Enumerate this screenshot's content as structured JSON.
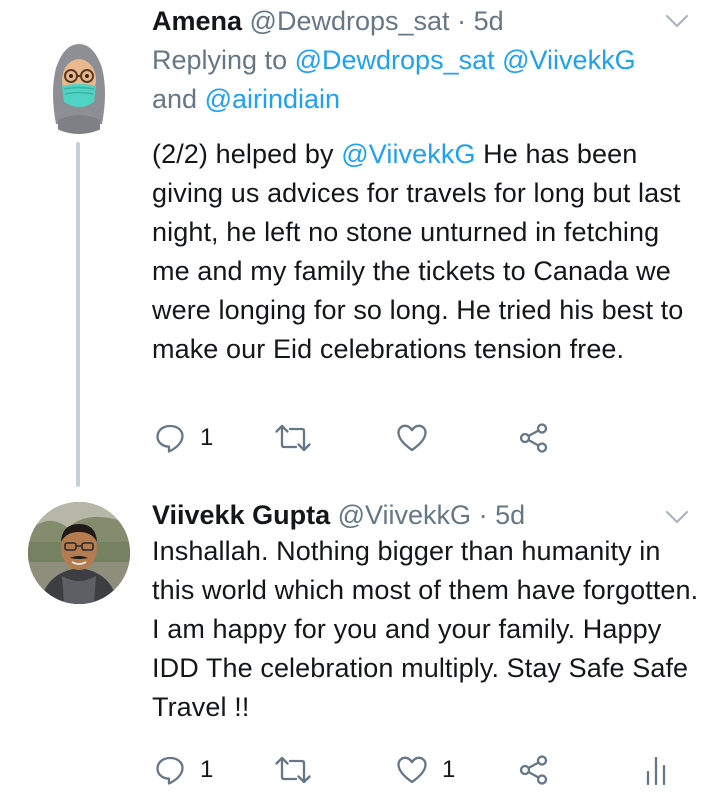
{
  "tweets": [
    {
      "name": "Amena",
      "handle": "@Dewdrops_sat",
      "dot": "·",
      "time": "5d",
      "replying_prefix": "Replying to",
      "replying_mention1": "@Dewdrops_sat",
      "replying_mention2": "@ViivekkG",
      "replying_and": "and",
      "replying_mention3": "@airindiain",
      "body_pre": "(2/2) helped by ",
      "body_mention": "@ViivekkG",
      "body_post": " He has been giving us advices for travels for long but last night, he left no stone unturned in fetching me and my family the tickets to Canada we were longing for so long. He tried his best to make our Eid celebrations tension free.",
      "reply_count": "1",
      "retweet_count": "",
      "like_count": ""
    },
    {
      "name": "Viivekk Gupta",
      "handle": "@ViivekkG",
      "dot": "·",
      "time": "5d",
      "body": "Inshallah. Nothing bigger than humanity in this world which most of them have forgotten. I am happy for you and your family. Happy IDD The celebration multiply. Stay Safe Safe Travel !!",
      "reply_count": "1",
      "retweet_count": "",
      "like_count": "1"
    }
  ],
  "colors": {
    "mention": "#1da1f2",
    "secondary_text": "#657786",
    "thread_line": "#c4cfd6"
  },
  "icons": [
    "reply-icon",
    "retweet-icon",
    "like-icon",
    "share-icon",
    "analytics-icon",
    "chevron-down-icon"
  ]
}
